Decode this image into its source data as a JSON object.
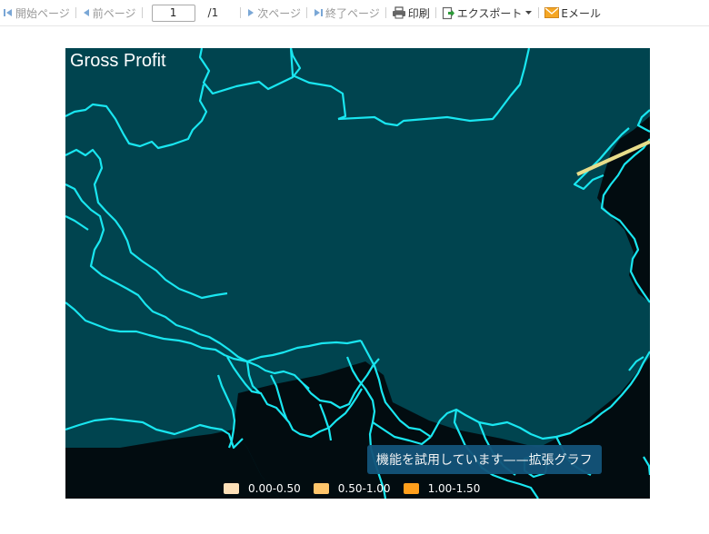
{
  "toolbar": {
    "first_page": "開始ページ",
    "prev_page": "前ページ",
    "page_value": "1",
    "page_total": "/1",
    "next_page": "次ページ",
    "last_page": "終了ページ",
    "print": "印刷",
    "export": "エクスポート",
    "email": "Eメール"
  },
  "map": {
    "title": "Gross Profit",
    "watermark": "機能を試用しています——拡張グラフ",
    "legend": [
      {
        "label": "0.00-0.50",
        "color": "#fde0b8"
      },
      {
        "label": "0.50-1.00",
        "color": "#ffc56b"
      },
      {
        "label": "1.00-1.50",
        "color": "#ff9f1c"
      }
    ],
    "colors": {
      "land": "#00444f",
      "background": "#020c10",
      "border": "#19e6f0",
      "flow_line": "#e8dd8a"
    }
  }
}
